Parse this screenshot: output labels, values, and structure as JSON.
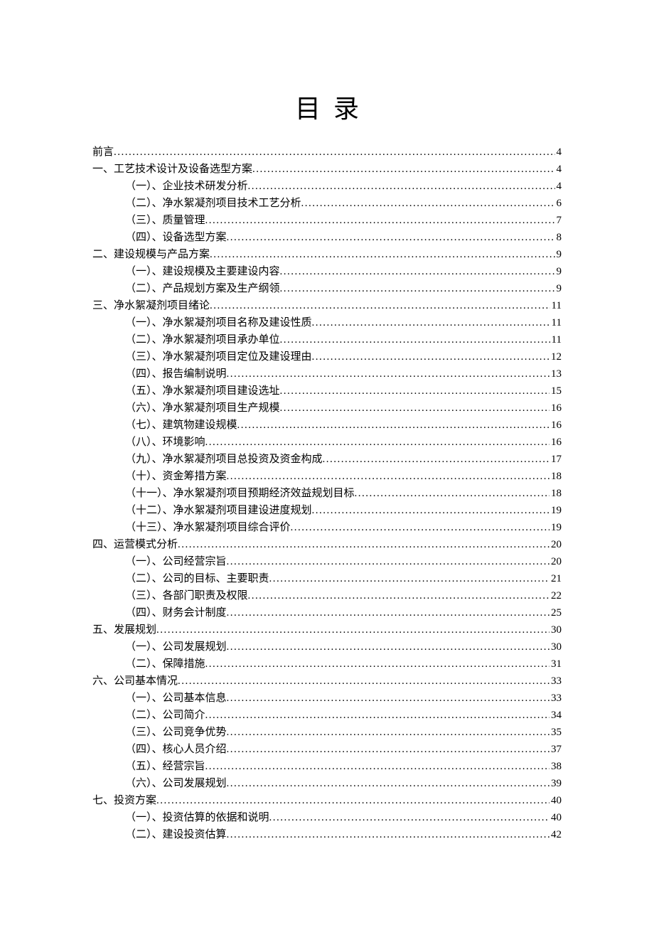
{
  "title": "目录",
  "toc": [
    {
      "level": 1,
      "label": "前言",
      "page": "4"
    },
    {
      "level": 1,
      "label": "一、工艺技术设计及设备选型方案",
      "page": "4"
    },
    {
      "level": 2,
      "label": "（一）、企业技术研发分析",
      "page": "4"
    },
    {
      "level": 2,
      "label": "（二）、净水絮凝剂项目技术工艺分析",
      "page": "6"
    },
    {
      "level": 2,
      "label": "（三）、质量管理",
      "page": "7"
    },
    {
      "level": 2,
      "label": "（四）、设备选型方案",
      "page": "8"
    },
    {
      "level": 1,
      "label": "二、建设规模与产品方案",
      "page": "9"
    },
    {
      "level": 2,
      "label": "（一）、建设规模及主要建设内容",
      "page": "9"
    },
    {
      "level": 2,
      "label": "（二）、产品规划方案及生产纲领",
      "page": "9"
    },
    {
      "level": 1,
      "label": "三、净水絮凝剂项目绪论",
      "page": "11"
    },
    {
      "level": 2,
      "label": "（一）、净水絮凝剂项目名称及建设性质",
      "page": "11"
    },
    {
      "level": 2,
      "label": "（二）、净水絮凝剂项目承办单位",
      "page": "11"
    },
    {
      "level": 2,
      "label": "（三）、净水絮凝剂项目定位及建设理由",
      "page": "12"
    },
    {
      "level": 2,
      "label": "（四）、报告编制说明",
      "page": "13"
    },
    {
      "level": 2,
      "label": "（五）、净水絮凝剂项目建设选址",
      "page": "15"
    },
    {
      "level": 2,
      "label": "（六）、净水絮凝剂项目生产规模",
      "page": "16"
    },
    {
      "level": 2,
      "label": "（七）、建筑物建设规模",
      "page": "16"
    },
    {
      "level": 2,
      "label": "（八）、环境影响",
      "page": "16"
    },
    {
      "level": 2,
      "label": "（九）、净水絮凝剂项目总投资及资金构成",
      "page": "17"
    },
    {
      "level": 2,
      "label": "（十）、资金筹措方案",
      "page": "18"
    },
    {
      "level": 2,
      "label": "（十一）、净水絮凝剂项目预期经济效益规划目标",
      "page": "18"
    },
    {
      "level": 2,
      "label": "（十二）、净水絮凝剂项目建设进度规划",
      "page": "19"
    },
    {
      "level": 2,
      "label": "（十三）、净水絮凝剂项目综合评价",
      "page": "19"
    },
    {
      "level": 1,
      "label": "四、运营模式分析",
      "page": "20"
    },
    {
      "level": 2,
      "label": "（一）、公司经营宗旨",
      "page": "20"
    },
    {
      "level": 2,
      "label": "（二）、公司的目标、主要职责",
      "page": "21"
    },
    {
      "level": 2,
      "label": "（三）、各部门职责及权限",
      "page": "22"
    },
    {
      "level": 2,
      "label": "（四）、财务会计制度",
      "page": "25"
    },
    {
      "level": 1,
      "label": "五、发展规划",
      "page": "30"
    },
    {
      "level": 2,
      "label": "（一）、公司发展规划",
      "page": "30"
    },
    {
      "level": 2,
      "label": "（二）、保障措施",
      "page": "31"
    },
    {
      "level": 1,
      "label": "六、公司基本情况",
      "page": "33"
    },
    {
      "level": 2,
      "label": "（一）、公司基本信息",
      "page": "33"
    },
    {
      "level": 2,
      "label": "（二）、公司简介",
      "page": "34"
    },
    {
      "level": 2,
      "label": "（三）、公司竞争优势",
      "page": "35"
    },
    {
      "level": 2,
      "label": "（四）、核心人员介绍",
      "page": "37"
    },
    {
      "level": 2,
      "label": "（五）、经营宗旨",
      "page": "38"
    },
    {
      "level": 2,
      "label": "（六）、公司发展规划",
      "page": "39"
    },
    {
      "level": 1,
      "label": "七、投资方案",
      "page": "40"
    },
    {
      "level": 2,
      "label": "（一）、投资估算的依据和说明",
      "page": "40"
    },
    {
      "level": 2,
      "label": "（二）、建设投资估算",
      "page": "42"
    }
  ]
}
